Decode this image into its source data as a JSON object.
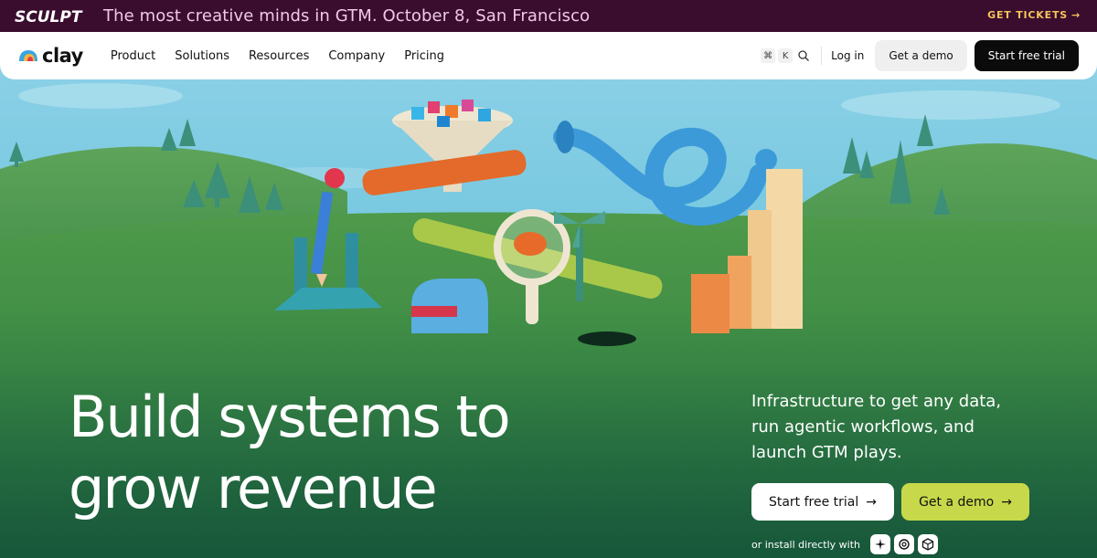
{
  "announcement": {
    "logo": "SCULPT",
    "text": "The most creative minds in GTM. October 8, San Francisco",
    "cta": "GET TICKETS",
    "cta_icon": "arrow-right-icon",
    "background": "#3a0d2f",
    "text_color": "#f0c9e6",
    "cta_color": "#f4c45a"
  },
  "nav": {
    "brand": "clay",
    "links": [
      "Product",
      "Solutions",
      "Resources",
      "Company",
      "Pricing"
    ],
    "shortcut_keys": [
      "⌘",
      "K"
    ],
    "search_icon": "search-icon",
    "login": "Log in",
    "demo": "Get a demo",
    "trial": "Start free trial"
  },
  "hero": {
    "headline_line1": "Build systems to",
    "headline_line2": "grow revenue",
    "subhead": "Infrastructure to get any data, run agentic workflows, and launch GTM plays.",
    "cta_trial": "Start free trial",
    "cta_demo": "Get a demo",
    "cta_icon": "arrow-right-icon",
    "install_text": "or install directly with",
    "install_icons": [
      "sparkle-icon",
      "openai-icon",
      "cube-icon"
    ],
    "accent": "#c7d94a"
  }
}
